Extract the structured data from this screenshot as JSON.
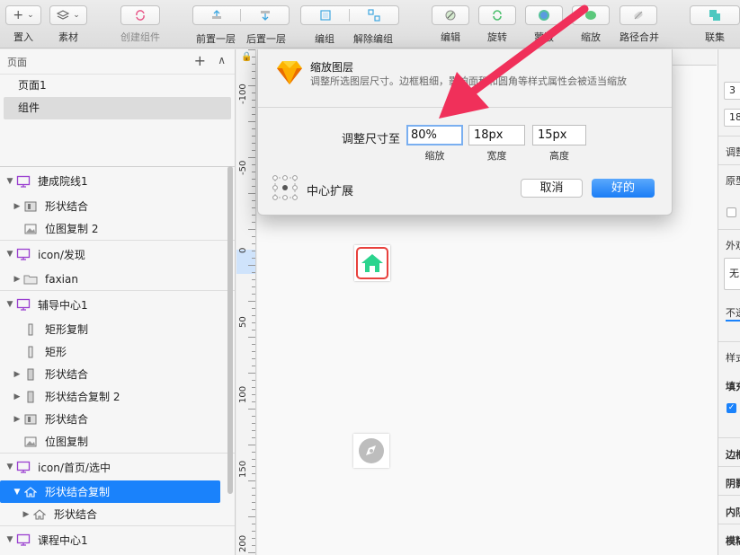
{
  "toolbar": {
    "insert": "置入",
    "symbol": "素材",
    "create_symbol": "创建组件",
    "forward": "前置一层",
    "backward": "后置一层",
    "group": "编组",
    "ungroup": "解除编组",
    "edit": "编辑",
    "rotate": "旋转",
    "mask": "蒙版",
    "scale": "缩放",
    "combine": "路径合并",
    "link": "联集"
  },
  "pages": {
    "header": "页面",
    "items": [
      "页面1",
      "组件"
    ],
    "active_index": 1
  },
  "layers": [
    {
      "label": "捷成院线1",
      "kind": "artboard"
    },
    {
      "label": "形状结合",
      "kind": "shape-combo",
      "indent": 1
    },
    {
      "label": "位图复制 2",
      "kind": "image",
      "indent": 1
    },
    {
      "label": "icon/发现",
      "kind": "artboard"
    },
    {
      "label": "faxian",
      "kind": "folder",
      "indent": 1
    },
    {
      "label": "辅导中心1",
      "kind": "artboard"
    },
    {
      "label": "矩形复制",
      "kind": "rect",
      "indent": 1
    },
    {
      "label": "矩形",
      "kind": "rect",
      "indent": 1
    },
    {
      "label": "形状结合",
      "kind": "shape",
      "indent": 1
    },
    {
      "label": "形状结合复制 2",
      "kind": "shape",
      "indent": 1
    },
    {
      "label": "形状结合",
      "kind": "shape-combo",
      "indent": 1
    },
    {
      "label": "位图复制",
      "kind": "image",
      "indent": 1
    },
    {
      "label": "icon/首页/选中",
      "kind": "artboard"
    },
    {
      "label": "形状结合复制",
      "kind": "home",
      "indent": 1,
      "selected": true
    },
    {
      "label": "形状结合",
      "kind": "home",
      "indent": 2
    },
    {
      "label": "课程中心1",
      "kind": "artboard"
    }
  ],
  "ruler": {
    "labels": [
      "-100",
      "-50",
      "0",
      "50",
      "100",
      "150",
      "200"
    ]
  },
  "dialog": {
    "title": "缩放图层",
    "description": "调整所选图层尺寸。边框粗细，影响面积和圆角等样式属性会被适当缩放",
    "resize_label": "调整尺寸至",
    "scale_value": "80%",
    "width_value": "18px",
    "height_value": "15px",
    "scale_caption": "缩放",
    "width_caption": "宽度",
    "height_caption": "高度",
    "center_label": "中心扩展",
    "cancel": "取消",
    "ok": "好的"
  },
  "inspector": {
    "x_value": "3",
    "y_value": "18",
    "adjust": "调整",
    "prototype": "原型",
    "appearance": "外观",
    "none": "无",
    "opacity": "不透",
    "style": "样式",
    "fill": "填充",
    "border": "边框",
    "shadow": "阴影",
    "inner_shadow": "内阴",
    "blur": "模糊"
  },
  "colors": {
    "accent": "#1a82fb",
    "annotation_arrow": "#f0305a",
    "home_icon": "#2bd48e",
    "selection_frame": "#e8413d"
  }
}
